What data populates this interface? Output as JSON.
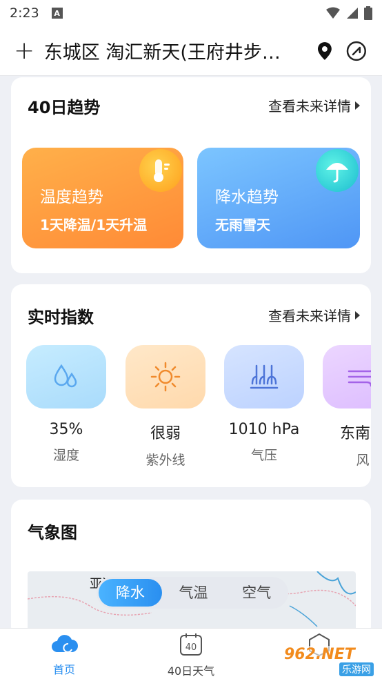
{
  "status": {
    "time": "2:23",
    "a_icon": "A"
  },
  "header": {
    "title": "东城区 淘汇新天(王府井步…"
  },
  "trend_card": {
    "title": "40日趋势",
    "more": "查看未来详情",
    "temp": {
      "title": "温度趋势",
      "desc": "1天降温/1天升温"
    },
    "rain": {
      "title": "降水趋势",
      "desc": "无雨雪天"
    }
  },
  "index_card": {
    "title": "实时指数",
    "more": "查看未来详情",
    "items": [
      {
        "value": "35%",
        "label": "湿度",
        "icon": "humidity-drops-icon"
      },
      {
        "value": "很弱",
        "label": "紫外线",
        "icon": "sun-icon"
      },
      {
        "value": "1010 hPa",
        "label": "气压",
        "icon": "pressure-icon"
      },
      {
        "value": "东南风",
        "label": "风",
        "icon": "wind-icon"
      }
    ]
  },
  "map_card": {
    "title": "气象图",
    "map_label": "亚洲",
    "tabs": [
      "降水",
      "气温",
      "空气"
    ]
  },
  "nav": {
    "home": "首页",
    "forty": "40日天气",
    "forty_badge": "40"
  },
  "watermark": {
    "text": "962.NET",
    "sub": "乐游网"
  },
  "colors": {
    "accent": "#2a8ff0",
    "orange": "#ff9a3c",
    "blue": "#4aa3ff"
  }
}
